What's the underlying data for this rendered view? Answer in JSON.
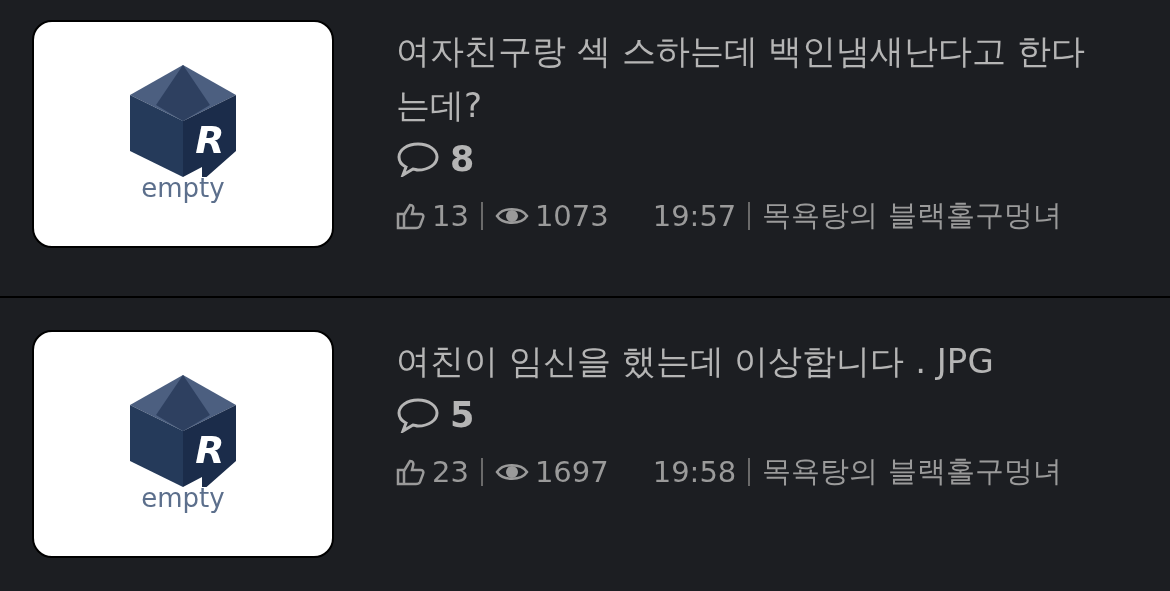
{
  "posts": [
    {
      "thumbnail": {
        "logo_letter": "R",
        "caption": "empty"
      },
      "title": "여자친구랑 섹 스하는데 백인냄새난다고 한다는데?",
      "comments": "8",
      "likes": "13",
      "views": "1073",
      "time": "19:57",
      "author": "목욕탕의 블랙홀구멍녀"
    },
    {
      "thumbnail": {
        "logo_letter": "R",
        "caption": "empty"
      },
      "title": "여친이 임신을 했는데 이상합니다 . JPG",
      "comments": "5",
      "likes": "23",
      "views": "1697",
      "time": "19:58",
      "author": "목욕탕의 블랙홀구멍녀"
    }
  ]
}
